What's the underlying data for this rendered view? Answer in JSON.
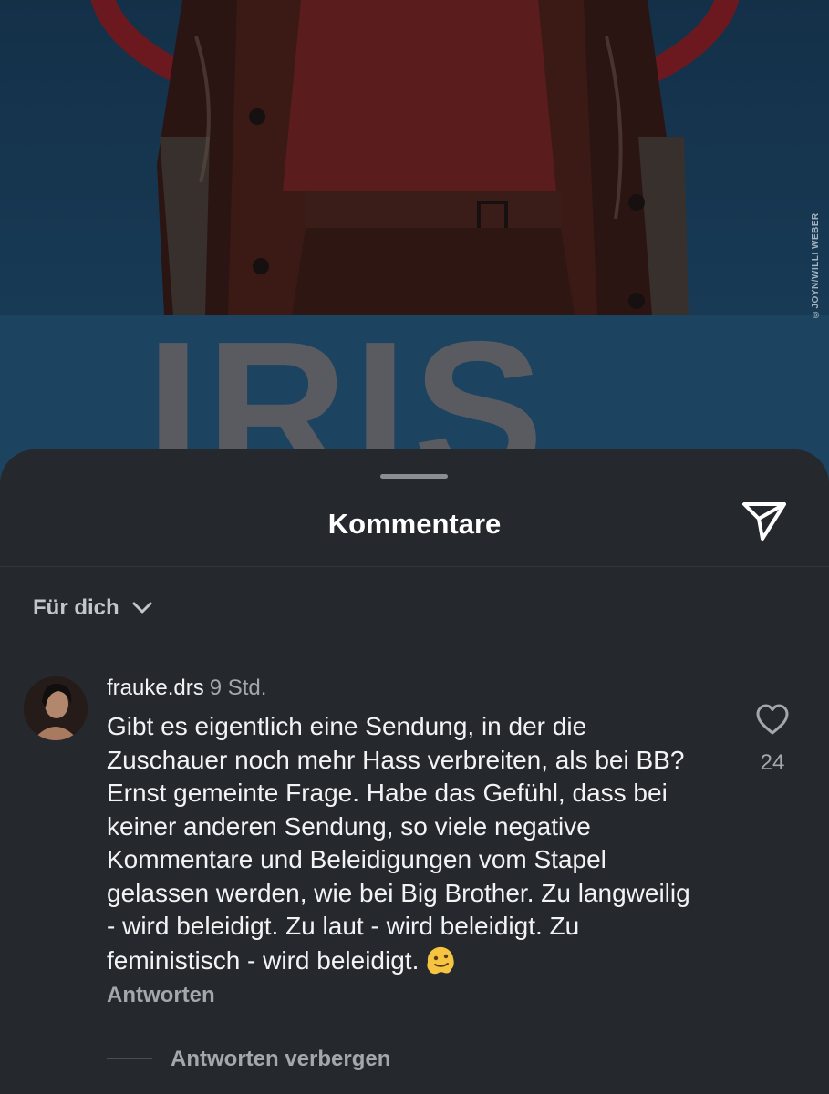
{
  "post_image": {
    "photo_credit": "©JOYN/WILLI WEBER",
    "big_name": "IRIS"
  },
  "comments_sheet": {
    "title": "Kommentare",
    "share_icon": "paper-plane-icon",
    "filter": {
      "label": "Für dich",
      "icon": "chevron-down-icon"
    },
    "comments": [
      {
        "username": "frauke.drs",
        "time": "9 Std.",
        "text": "Gibt es eigentlich eine Sendung, in der die Zuschauer noch mehr Hass verbreiten, als bei BB? Ernst gemeinte Frage. Habe das Gefühl, dass bei keiner anderen Sendung, so viele negative Kommentare und Beleidigungen vom Stapel gelassen werden, wie bei Big Brother. Zu langweilig - wird beleidigt. Zu laut - wird beleidigt. Zu feministisch - wird beleidigt.",
        "emoji": "melting-face-icon",
        "like_count": "24",
        "reply_label": "Antworten",
        "hide_replies_label": "Antworten verbergen"
      }
    ]
  },
  "colors": {
    "sheet_background": "#25282d",
    "text_primary": "#f2f3f5",
    "text_secondary": "#a4a8ad",
    "image_background": "#1c4360"
  }
}
